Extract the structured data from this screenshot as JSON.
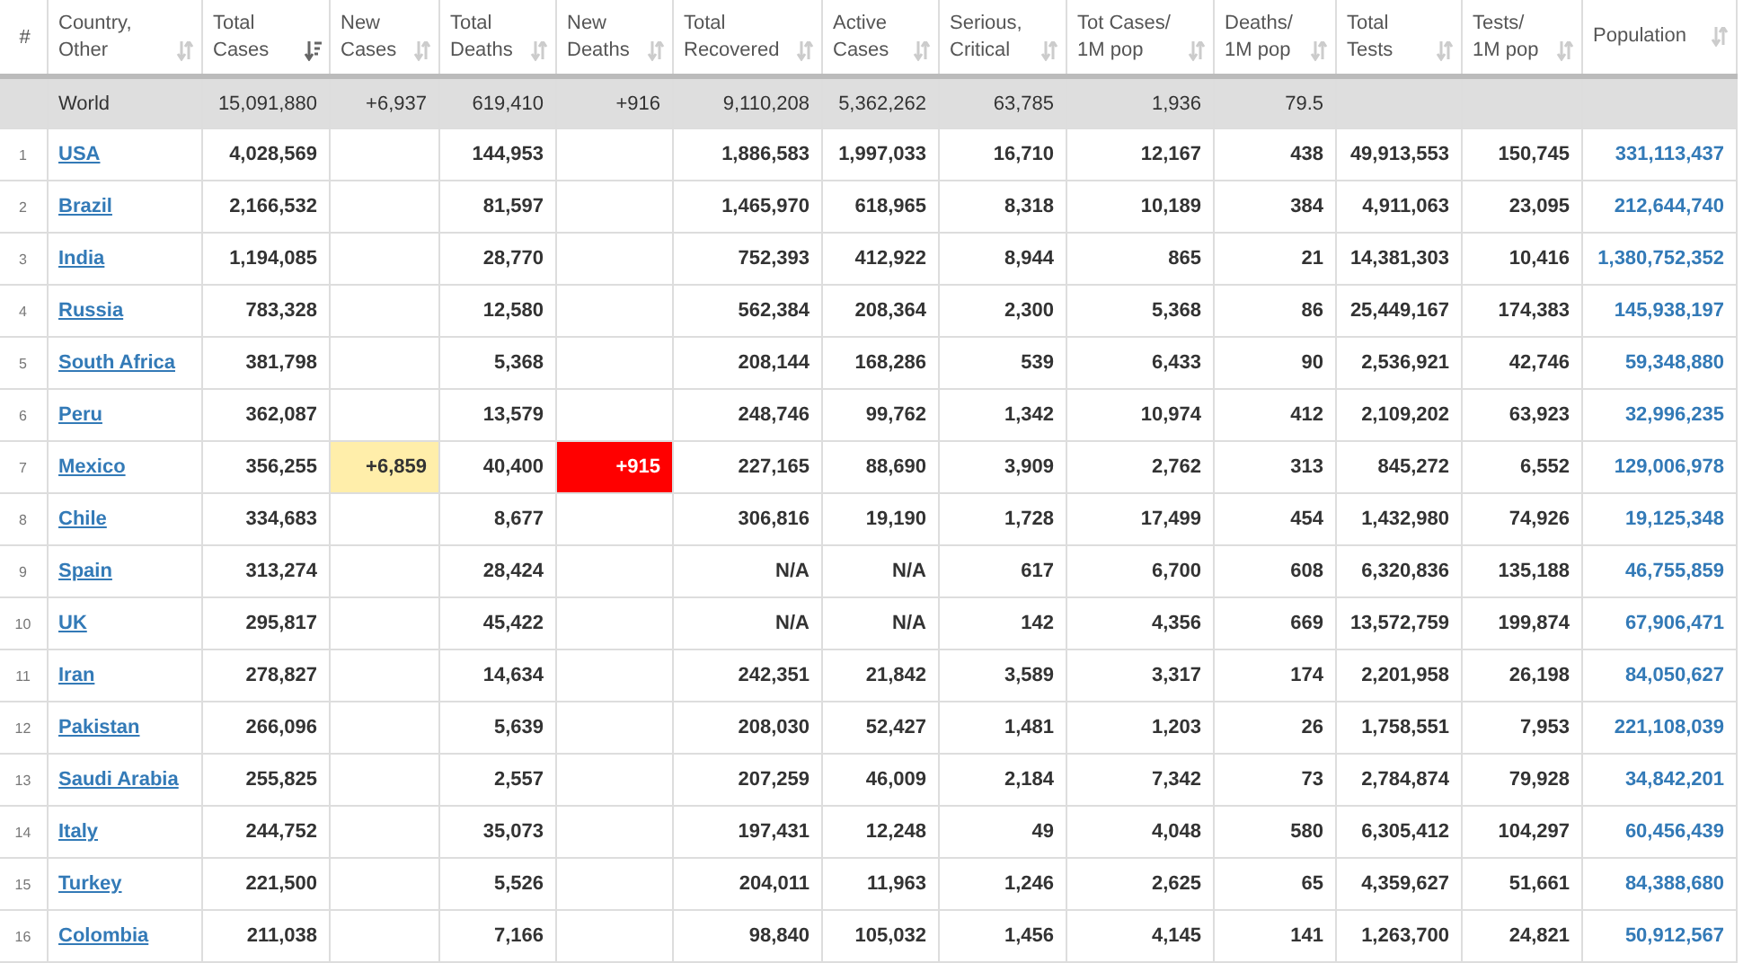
{
  "columns": [
    {
      "label": "#",
      "sortable": false
    },
    {
      "label": "Country,\nOther",
      "sortable": true,
      "sorted": false
    },
    {
      "label": "Total\nCases",
      "sortable": true,
      "sorted": true
    },
    {
      "label": "New\nCases",
      "sortable": true,
      "sorted": false
    },
    {
      "label": "Total\nDeaths",
      "sortable": true,
      "sorted": false
    },
    {
      "label": "New\nDeaths",
      "sortable": true,
      "sorted": false
    },
    {
      "label": "Total\nRecovered",
      "sortable": true,
      "sorted": false
    },
    {
      "label": "Active\nCases",
      "sortable": true,
      "sorted": false
    },
    {
      "label": "Serious,\nCritical",
      "sortable": true,
      "sorted": false
    },
    {
      "label": "Tot Cases/\n1M pop",
      "sortable": true,
      "sorted": false
    },
    {
      "label": "Deaths/\n1M pop",
      "sortable": true,
      "sorted": false
    },
    {
      "label": "Total\nTests",
      "sortable": true,
      "sorted": false
    },
    {
      "label": "Tests/\n1M pop",
      "sortable": true,
      "sorted": false
    },
    {
      "label": "Population",
      "sortable": true,
      "sorted": false
    }
  ],
  "world": {
    "country": "World",
    "cells": [
      "15,091,880",
      "+6,937",
      "619,410",
      "+916",
      "9,110,208",
      "5,362,262",
      "63,785",
      "1,936",
      "79.5",
      null,
      null,
      null
    ]
  },
  "rows": [
    {
      "rank": "1",
      "country": "USA",
      "cells": [
        "4,028,569",
        null,
        "144,953",
        null,
        "1,886,583",
        "1,997,033",
        "16,710",
        "12,167",
        "438",
        "49,913,553",
        "150,745",
        "331,113,437"
      ]
    },
    {
      "rank": "2",
      "country": "Brazil",
      "cells": [
        "2,166,532",
        null,
        "81,597",
        null,
        "1,465,970",
        "618,965",
        "8,318",
        "10,189",
        "384",
        "4,911,063",
        "23,095",
        "212,644,740"
      ]
    },
    {
      "rank": "3",
      "country": "India",
      "cells": [
        "1,194,085",
        null,
        "28,770",
        null,
        "752,393",
        "412,922",
        "8,944",
        "865",
        "21",
        "14,381,303",
        "10,416",
        "1,380,752,352"
      ]
    },
    {
      "rank": "4",
      "country": "Russia",
      "cells": [
        "783,328",
        null,
        "12,580",
        null,
        "562,384",
        "208,364",
        "2,300",
        "5,368",
        "86",
        "25,449,167",
        "174,383",
        "145,938,197"
      ]
    },
    {
      "rank": "5",
      "country": "South Africa",
      "cells": [
        "381,798",
        null,
        "5,368",
        null,
        "208,144",
        "168,286",
        "539",
        "6,433",
        "90",
        "2,536,921",
        "42,746",
        "59,348,880"
      ]
    },
    {
      "rank": "6",
      "country": "Peru",
      "cells": [
        "362,087",
        null,
        "13,579",
        null,
        "248,746",
        "99,762",
        "1,342",
        "10,974",
        "412",
        "2,109,202",
        "63,923",
        "32,996,235"
      ]
    },
    {
      "rank": "7",
      "country": "Mexico",
      "cells": [
        "356,255",
        "+6,859",
        "40,400",
        "+915",
        "227,165",
        "88,690",
        "3,909",
        "2,762",
        "313",
        "845,272",
        "6,552",
        "129,006,978"
      ]
    },
    {
      "rank": "8",
      "country": "Chile",
      "cells": [
        "334,683",
        null,
        "8,677",
        null,
        "306,816",
        "19,190",
        "1,728",
        "17,499",
        "454",
        "1,432,980",
        "74,926",
        "19,125,348"
      ]
    },
    {
      "rank": "9",
      "country": "Spain",
      "cells": [
        "313,274",
        null,
        "28,424",
        null,
        "N/A",
        "N/A",
        "617",
        "6,700",
        "608",
        "6,320,836",
        "135,188",
        "46,755,859"
      ]
    },
    {
      "rank": "10",
      "country": "UK",
      "cells": [
        "295,817",
        null,
        "45,422",
        null,
        "N/A",
        "N/A",
        "142",
        "4,356",
        "669",
        "13,572,759",
        "199,874",
        "67,906,471"
      ]
    },
    {
      "rank": "11",
      "country": "Iran",
      "cells": [
        "278,827",
        null,
        "14,634",
        null,
        "242,351",
        "21,842",
        "3,589",
        "3,317",
        "174",
        "2,201,958",
        "26,198",
        "84,050,627"
      ]
    },
    {
      "rank": "12",
      "country": "Pakistan",
      "cells": [
        "266,096",
        null,
        "5,639",
        null,
        "208,030",
        "52,427",
        "1,481",
        "1,203",
        "26",
        "1,758,551",
        "7,953",
        "221,108,039"
      ]
    },
    {
      "rank": "13",
      "country": "Saudi Arabia",
      "cells": [
        "255,825",
        null,
        "2,557",
        null,
        "207,259",
        "46,009",
        "2,184",
        "7,342",
        "73",
        "2,784,874",
        "79,928",
        "34,842,201"
      ]
    },
    {
      "rank": "14",
      "country": "Italy",
      "cells": [
        "244,752",
        null,
        "35,073",
        null,
        "197,431",
        "12,248",
        "49",
        "4,048",
        "580",
        "6,305,412",
        "104,297",
        "60,456,439"
      ]
    },
    {
      "rank": "15",
      "country": "Turkey",
      "cells": [
        "221,500",
        null,
        "5,526",
        null,
        "204,011",
        "11,963",
        "1,246",
        "2,625",
        "65",
        "4,359,627",
        "51,661",
        "84,388,680"
      ]
    },
    {
      "rank": "16",
      "country": "Colombia",
      "cells": [
        "211,038",
        null,
        "7,166",
        null,
        "98,840",
        "105,032",
        "1,456",
        "4,145",
        "141",
        "1,263,700",
        "24,821",
        "50,912,567"
      ]
    }
  ]
}
